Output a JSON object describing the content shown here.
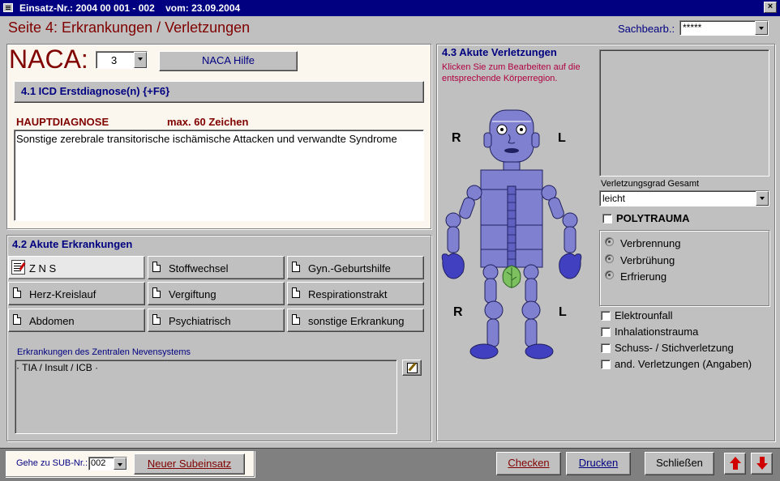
{
  "window": {
    "title": "Einsatz-Nr.: 2004 00 001 - 002    vom: 23.09.2004",
    "close_glyph": "×"
  },
  "header": {
    "page_title": "Seite 4: Erkrankungen / Verletzungen",
    "sachbearb_label": "Sachbearb.:",
    "sachbearb_value": "*****"
  },
  "naca": {
    "label": "NACA:",
    "value": "3",
    "help_button": "NACA Hilfe"
  },
  "icd": {
    "button_label": "4.1 ICD Erstdiagnose(n)  {+F6}"
  },
  "hauptdiagnose": {
    "label": "HAUPTDIAGNOSE",
    "max_hint": "max. 60 Zeichen",
    "text": "Sonstige zerebrale transitorische ischämische Attacken und verwandte Syndrome"
  },
  "erkrankungen": {
    "heading": "4.2 Akute Erkrankungen",
    "categories": [
      {
        "label": "Z N S",
        "active": true
      },
      {
        "label": "Stoffwechsel"
      },
      {
        "label": "Gyn.-Geburtshilfe"
      },
      {
        "label": "Herz-Kreislauf"
      },
      {
        "label": "Vergiftung"
      },
      {
        "label": "Respirationstrakt"
      },
      {
        "label": "Abdomen"
      },
      {
        "label": "Psychiatrisch"
      },
      {
        "label": "sonstige Erkrankung"
      }
    ],
    "detail_label": "Erkrankungen des Zentralen Nevensystems",
    "detail_text": "· TIA / Insult / ICB ·"
  },
  "verletzungen": {
    "heading": "4.3 Akute Verletzungen",
    "hint": "Klicken Sie zum Bearbeiten auf die entsprechende Körperregion.",
    "side_right": "R",
    "side_left": "L",
    "grad_label": "Verletzungsgrad Gesamt",
    "grad_value": "leicht",
    "polytrauma_label": "POLYTRAUMA",
    "radios": [
      "Verbrennung",
      "Verbrühung",
      "Erfrierung"
    ],
    "checkboxes": [
      "Elektrounfall",
      "Inhalationstrauma",
      "Schuss- / Stichverletzung",
      "and. Verletzungen (Angaben)"
    ]
  },
  "footer": {
    "goto_label": "Gehe zu SUB-Nr.:",
    "goto_value": "002",
    "neuer_button": "Neuer Subeinsatz",
    "checken": "Checken",
    "drucken": "Drucken",
    "schliessen": "Schließen"
  },
  "colors": {
    "title_bar": "#000080",
    "heading_red": "#800000",
    "heading_blue": "#000080",
    "body_fill": "#8080d0",
    "panel_cream": "#fbf7ee"
  }
}
